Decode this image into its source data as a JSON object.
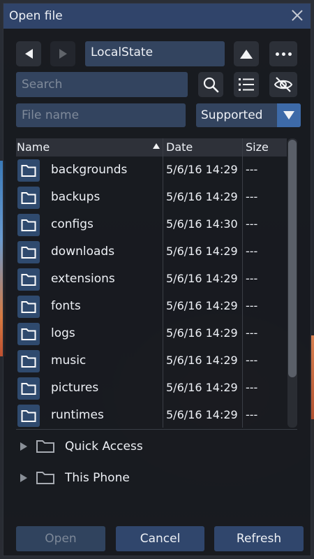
{
  "dialog": {
    "title": "Open file"
  },
  "nav": {
    "current_path": "LocalState"
  },
  "search": {
    "placeholder": "Search"
  },
  "filename": {
    "placeholder": "File name"
  },
  "filter": {
    "selected": "Supported"
  },
  "table": {
    "headers": {
      "name": "Name",
      "date": "Date",
      "size": "Size"
    },
    "rows": [
      {
        "name": "backgrounds",
        "date": "5/6/16 14:29",
        "size": "---"
      },
      {
        "name": "backups",
        "date": "5/6/16 14:29",
        "size": "---"
      },
      {
        "name": "configs",
        "date": "5/6/16 14:30",
        "size": "---"
      },
      {
        "name": "downloads",
        "date": "5/6/16 14:29",
        "size": "---"
      },
      {
        "name": "extensions",
        "date": "5/6/16 14:29",
        "size": "---"
      },
      {
        "name": "fonts",
        "date": "5/6/16 14:29",
        "size": "---"
      },
      {
        "name": "logs",
        "date": "5/6/16 14:29",
        "size": "---"
      },
      {
        "name": "music",
        "date": "5/6/16 14:29",
        "size": "---"
      },
      {
        "name": "pictures",
        "date": "5/6/16 14:29",
        "size": "---"
      },
      {
        "name": "runtimes",
        "date": "5/6/16 14:29",
        "size": "---"
      }
    ]
  },
  "places": {
    "quick_access": "Quick Access",
    "this_phone": "This Phone"
  },
  "footer": {
    "open": "Open",
    "cancel": "Cancel",
    "refresh": "Refresh"
  },
  "icons": {
    "folder": "folder-icon",
    "search": "search-icon",
    "list": "list-view-icon",
    "hidden": "eye-slash-icon"
  },
  "colors": {
    "titlebar": "#30446a",
    "accent": "#3d6aa8",
    "field": "#33445f"
  }
}
